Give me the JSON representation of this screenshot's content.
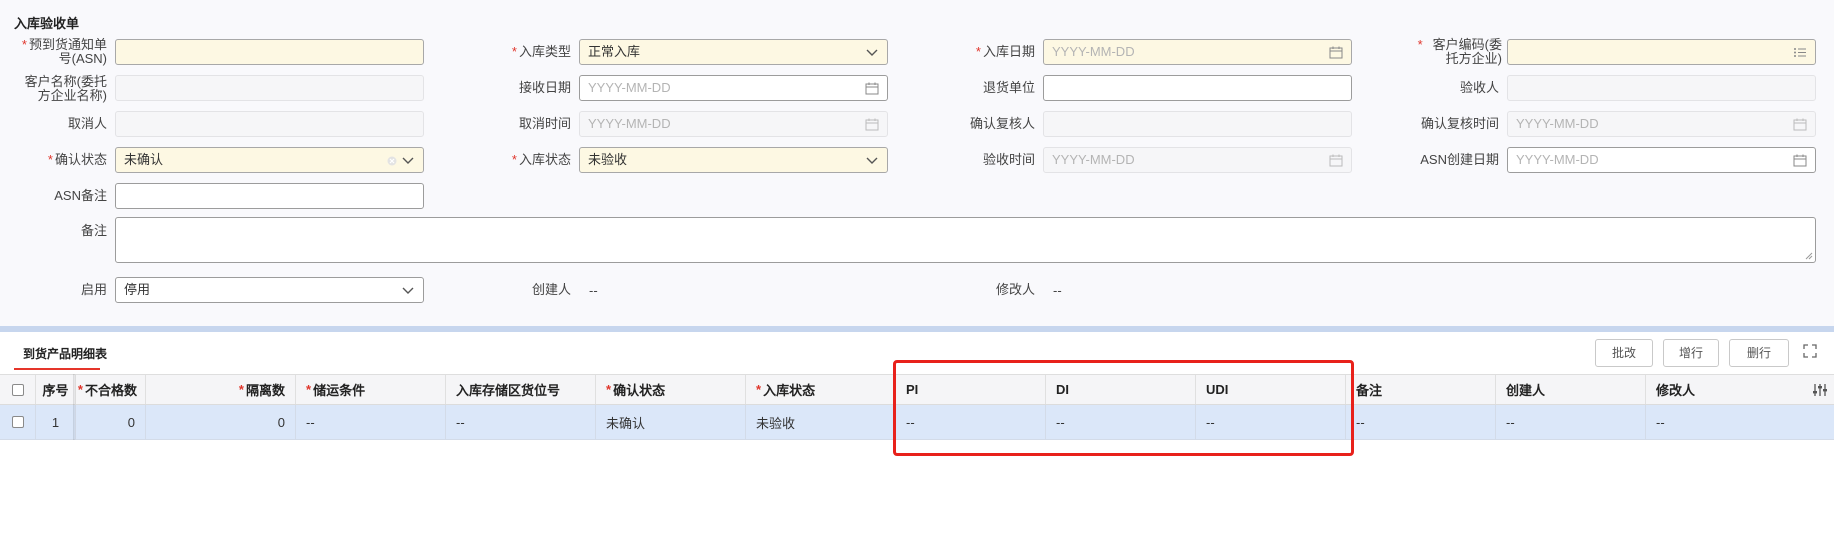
{
  "form": {
    "title": "入库验收单",
    "labels": {
      "asn_line1": "预到货通知单",
      "asn_line2": "号(ASN)",
      "inbound_type": "入库类型",
      "inbound_date": "入库日期",
      "customer_code_line1": "客户编码(委",
      "customer_code_line2": "托方企业)",
      "customer_name_line1": "客户名称(委托",
      "customer_name_line2": "方企业名称)",
      "receive_date": "接收日期",
      "return_unit": "退货单位",
      "inspector": "验收人",
      "canceller": "取消人",
      "cancel_time": "取消时间",
      "review_confirmer": "确认复核人",
      "review_confirm_time": "确认复核时间",
      "confirm_status": "确认状态",
      "inbound_status": "入库状态",
      "inspect_time": "验收时间",
      "asn_created_date": "ASN创建日期",
      "asn_remark": "ASN备注",
      "remark": "备注",
      "enabled": "启用",
      "creator": "创建人",
      "modifier": "修改人"
    },
    "values": {
      "inbound_type": "正常入库",
      "confirm_status": "未确认",
      "inbound_status": "未验收",
      "enabled": "停用",
      "creator": "--",
      "modifier": "--"
    },
    "date_placeholder": "YYYY-MM-DD"
  },
  "detail": {
    "tab_label": "到货产品明细表",
    "buttons": {
      "batch_edit": "批改",
      "add_row": "增行",
      "delete_row": "删行"
    },
    "columns": {
      "seq": "序号",
      "unqualified": "不合格数",
      "isolated": "隔离数",
      "shipping": "储运条件",
      "location": "入库存储区货位号",
      "confirm_status": "确认状态",
      "inbound_status": "入库状态",
      "pi": "PI",
      "di": "DI",
      "udi": "UDI",
      "remark": "备注",
      "creator": "创建人",
      "modifier": "修改人"
    },
    "rows": [
      {
        "seq": "1",
        "unqualified": "0",
        "isolated": "0",
        "shipping": "--",
        "location": "--",
        "confirm_status": "未确认",
        "inbound_status": "未验收",
        "pi": "--",
        "di": "--",
        "udi": "--",
        "remark": "--",
        "creator": "--",
        "modifier": "--"
      }
    ]
  },
  "colors": {
    "required_star": "#e0352b",
    "required_field_bg": "#fdf8e3",
    "row_highlight": "#dbe7f9",
    "section_divider": "#c7d6ee",
    "highlight_box": "#e8211b"
  }
}
